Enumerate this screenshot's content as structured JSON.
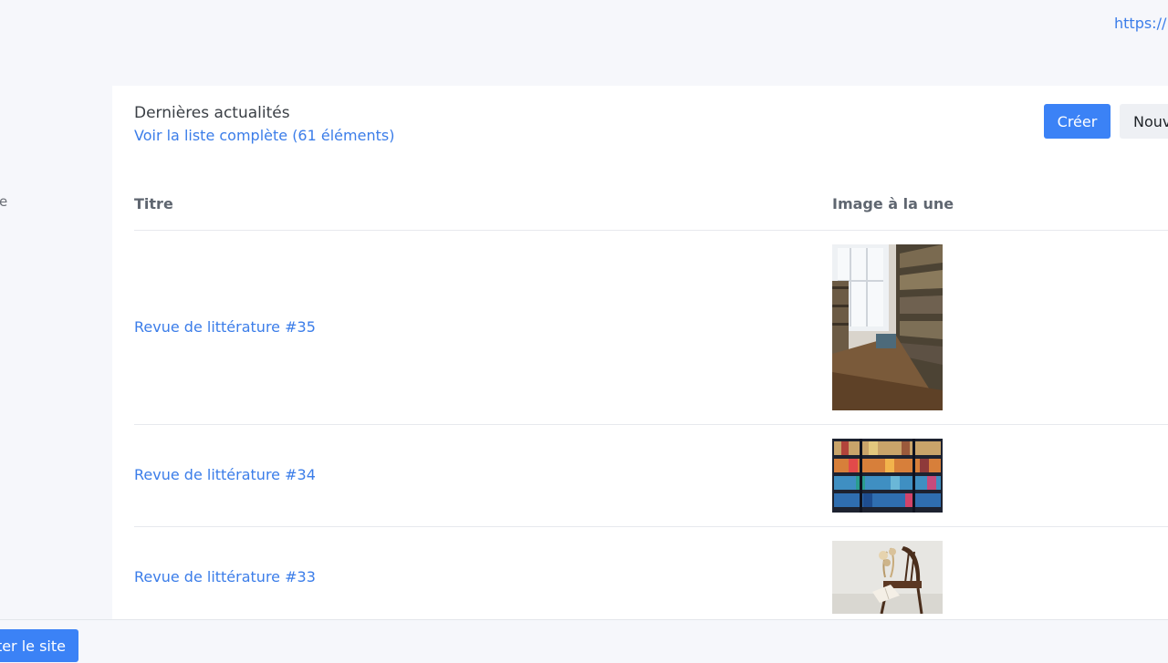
{
  "header": {
    "url_text": "https://"
  },
  "sidebar": {
    "partial_text": "e"
  },
  "news_card": {
    "title": "Dernières actualités",
    "see_all_link": "Voir la liste complète (61 éléments)",
    "create_button": "Créer",
    "second_button": "Nouv"
  },
  "table": {
    "columns": [
      "Titre",
      "Image à la une"
    ],
    "rows": [
      {
        "title": "Revue de littérature #35",
        "image": "library-interior-photo"
      },
      {
        "title": "Revue de littérature #34",
        "image": "colorful-bookshelf-photo"
      },
      {
        "title": "Revue de littérature #33",
        "image": "chair-with-open-book-photo"
      }
    ]
  },
  "footer": {
    "visit_button": "ter le site"
  },
  "colors": {
    "accent": "#3b82f6",
    "link": "#3b7de9",
    "page_bg": "#f6f7fb",
    "text_dark": "#3a3f45",
    "header_text": "#5f6670"
  }
}
